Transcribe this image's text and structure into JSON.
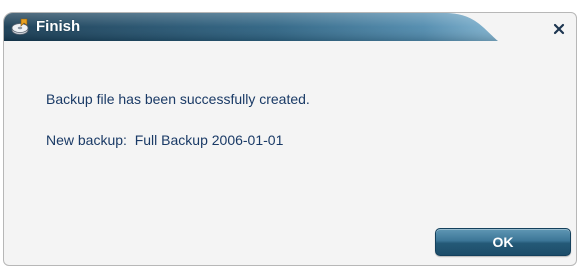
{
  "dialog": {
    "title": "Finish",
    "title_icon": "backup-drive-icon",
    "close_icon": "close-icon",
    "message_line1": "Backup file has been successfully created.",
    "message_line2": "New backup:  Full Backup 2006-01-01",
    "ok_label": "OK"
  },
  "colors": {
    "titlebar_dark": "#163a52",
    "titlebar_light": "#6fa3c2",
    "text": "#1a3a66",
    "button": "#2f6788",
    "background": "#f4f4f4"
  }
}
